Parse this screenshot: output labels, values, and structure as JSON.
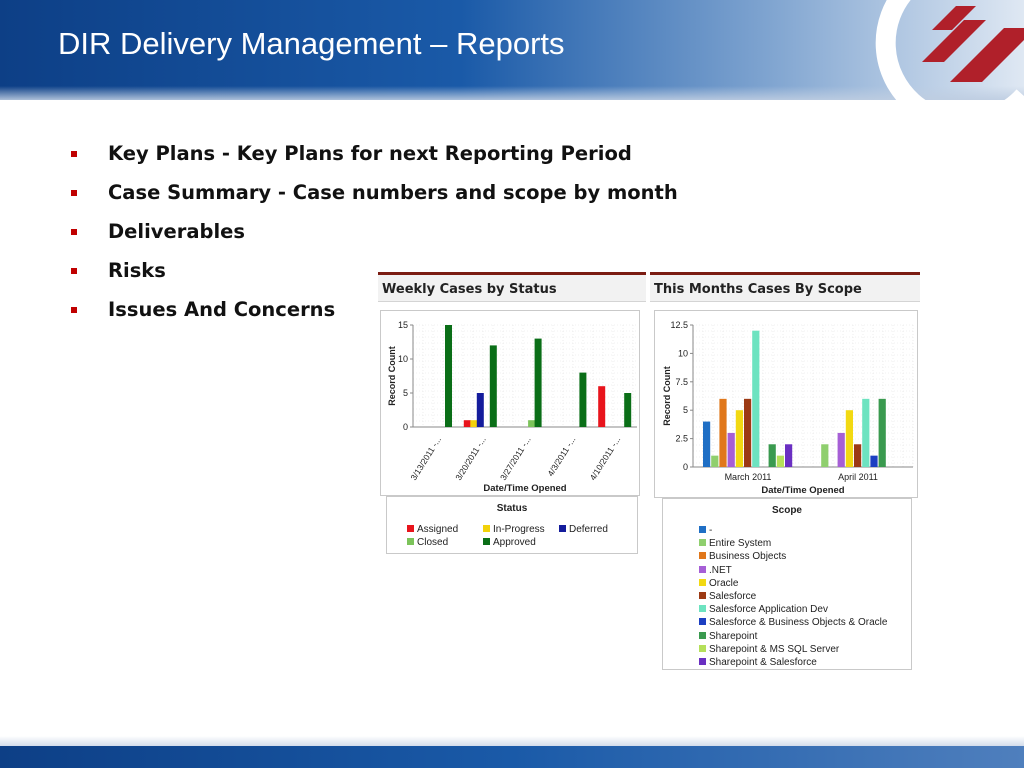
{
  "slide": {
    "title": "DIR Delivery Management – Reports",
    "bullets": [
      "Key Plans -  Key Plans for next Reporting Period",
      "Case Summary -  Case numbers and scope by  month",
      "Deliverables",
      "Risks",
      "Issues And Concerns"
    ]
  },
  "colors": {
    "header_blue": "#0d3f86",
    "bullet_red": "#c00000",
    "panel_accent": "#7b1c12"
  },
  "panels": {
    "weekly": {
      "title": "Weekly Cases by Status"
    },
    "monthly": {
      "title": "This Months Cases By Scope"
    }
  },
  "chart_data": [
    {
      "type": "bar",
      "title": "Weekly Cases by Status",
      "xlabel": "Date/Time Opened",
      "ylabel": "Record Count",
      "ylim": [
        0,
        15
      ],
      "yticks": [
        0,
        5,
        10,
        15
      ],
      "grid": true,
      "categories": [
        "3/13/2011 -...",
        "3/20/2011 -...",
        "3/27/2011 -...",
        "4/3/2011 -...",
        "4/10/2011 -..."
      ],
      "legend_title": "Status",
      "legend_position": "bottom",
      "series": [
        {
          "name": "Assigned",
          "color": "#e8141c",
          "values": [
            0,
            1,
            0,
            0,
            6
          ]
        },
        {
          "name": "In-Progress",
          "color": "#f2d20a",
          "values": [
            0,
            1,
            0,
            0,
            0
          ]
        },
        {
          "name": "Deferred",
          "color": "#141c9c",
          "values": [
            0,
            5,
            0,
            0,
            0
          ]
        },
        {
          "name": "Closed",
          "color": "#7cc35a",
          "values": [
            0,
            0,
            1,
            0,
            0
          ]
        },
        {
          "name": "Approved",
          "color": "#0a6e17",
          "values": [
            15,
            12,
            13,
            8,
            5
          ]
        }
      ]
    },
    {
      "type": "bar",
      "title": "This Months Cases By Scope",
      "xlabel": "Date/Time Opened",
      "ylabel": "Record Count",
      "ylim": [
        0,
        12.5
      ],
      "yticks": [
        0,
        2.5,
        5,
        7.5,
        10,
        12.5
      ],
      "grid": true,
      "categories": [
        "March 2011",
        "April 2011"
      ],
      "legend_title": "Scope",
      "legend_position": "bottom",
      "series": [
        {
          "name": "-",
          "color": "#1f6fc5",
          "values": [
            4,
            0
          ]
        },
        {
          "name": "Entire System",
          "color": "#8fcf6e",
          "values": [
            1,
            2
          ]
        },
        {
          "name": "Business Objects",
          "color": "#e0771b",
          "values": [
            6,
            0
          ]
        },
        {
          "name": ".NET",
          "color": "#a65fd6",
          "values": [
            3,
            3
          ]
        },
        {
          "name": "Oracle",
          "color": "#f2d912",
          "values": [
            5,
            5
          ]
        },
        {
          "name": "Salesforce",
          "color": "#9c3a14",
          "values": [
            6,
            2
          ]
        },
        {
          "name": "Salesforce Application Dev",
          "color": "#6de3c0",
          "values": [
            12,
            6
          ]
        },
        {
          "name": "Salesforce & Business Objects & Oracle",
          "color": "#1c3fc2",
          "values": [
            0,
            1
          ]
        },
        {
          "name": "Sharepoint",
          "color": "#3a9a4f",
          "values": [
            2,
            6
          ]
        },
        {
          "name": "Sharepoint & MS SQL Server",
          "color": "#b5e05a",
          "values": [
            1,
            0
          ]
        },
        {
          "name": "Sharepoint & Salesforce",
          "color": "#6a2fc2",
          "values": [
            2,
            0
          ]
        }
      ]
    }
  ]
}
